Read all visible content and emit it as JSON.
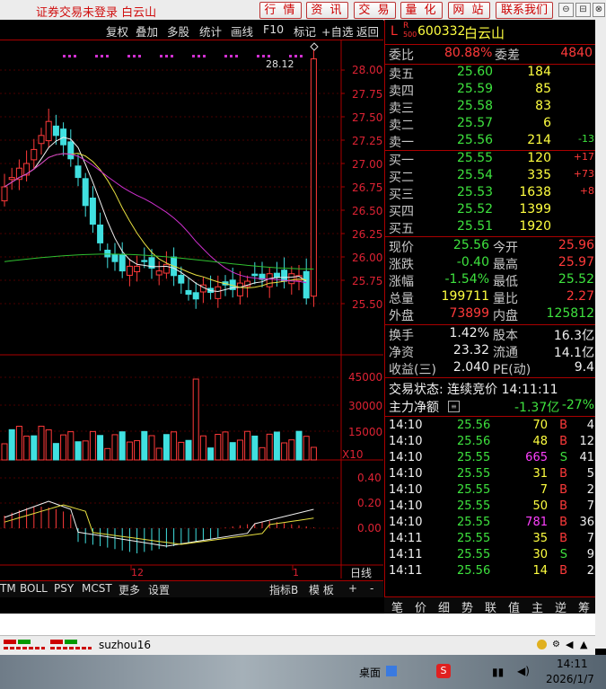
{
  "window": {
    "title": "证券交易未登录  白云山",
    "tabs": [
      "行 情",
      "资 讯",
      "交 易",
      "量 化",
      "网 站",
      "联系我们"
    ],
    "controls": [
      "⊖",
      "⊟",
      "⊗"
    ]
  },
  "chart_toolbar": [
    "复权",
    "叠加",
    "多股",
    "统计",
    "画线",
    "F10",
    "标记",
    "+自选",
    "返回"
  ],
  "price_axis": [
    "28.00",
    "27.75",
    "27.50",
    "27.25",
    "27.00",
    "26.75",
    "26.50",
    "26.25",
    "26.00",
    "25.75",
    "25.50"
  ],
  "volume_axis": [
    "45000",
    "30000",
    "15000",
    "X10"
  ],
  "macd_axis": [
    "0.40",
    "0.20",
    "0.00"
  ],
  "high_marker": "28.12",
  "date_labels": [
    "12",
    "1"
  ],
  "period_label": "日线",
  "chart_tabs": [
    "TM",
    "BOLL",
    "PSY",
    "MCST",
    "更多",
    "设置",
    "指标B",
    "模 板",
    "+",
    "-"
  ],
  "stock": {
    "code": "600332",
    "name": "白云山",
    "badge_top": "R",
    "badge_bottom": "500",
    "badge_left": "L"
  },
  "weibi": {
    "label": "委比",
    "value": "80.88%",
    "label2": "委差",
    "value2": "4840"
  },
  "sell": [
    {
      "label": "卖五",
      "price": "25.60",
      "vol": "184",
      "chg": ""
    },
    {
      "label": "卖四",
      "price": "25.59",
      "vol": "85",
      "chg": ""
    },
    {
      "label": "卖三",
      "price": "25.58",
      "vol": "83",
      "chg": ""
    },
    {
      "label": "卖二",
      "price": "25.57",
      "vol": "6",
      "chg": ""
    },
    {
      "label": "卖一",
      "price": "25.56",
      "vol": "214",
      "chg": "-13"
    }
  ],
  "buy": [
    {
      "label": "买一",
      "price": "25.55",
      "vol": "120",
      "chg": "+17"
    },
    {
      "label": "买二",
      "price": "25.54",
      "vol": "335",
      "chg": "+73"
    },
    {
      "label": "买三",
      "price": "25.53",
      "vol": "1638",
      "chg": "+8"
    },
    {
      "label": "买四",
      "price": "25.52",
      "vol": "1399",
      "chg": ""
    },
    {
      "label": "买五",
      "price": "25.51",
      "vol": "1920",
      "chg": ""
    }
  ],
  "stats": [
    {
      "l1": "现价",
      "v1": "25.56",
      "l2": "今开",
      "v2": "25.96"
    },
    {
      "l1": "涨跌",
      "v1": "-0.40",
      "l2": "最高",
      "v2": "25.97"
    },
    {
      "l1": "涨幅",
      "v1": "-1.54%",
      "l2": "最低",
      "v2": "25.52"
    },
    {
      "l1": "总量",
      "v1": "199711",
      "l2": "量比",
      "v2": "2.27"
    },
    {
      "l1": "外盘",
      "v1": "73899",
      "l2": "内盘",
      "v2": "125812"
    }
  ],
  "fundamentals": [
    {
      "l1": "换手",
      "v1": "1.42%",
      "l2": "股本",
      "v2": "16.3亿"
    },
    {
      "l1": "净资",
      "v1": "23.32",
      "l2": "流通",
      "v2": "14.1亿"
    },
    {
      "l1": "收益(三)",
      "v1": "2.040",
      "l2": "PE(动)",
      "v2": "9.4"
    }
  ],
  "trade_status": "交易状态: 连续竞价 14:11:11",
  "main_flow": {
    "label": "主力净额",
    "value": "-1.37亿",
    "pct": "-27%"
  },
  "trades": [
    {
      "t": "14:10",
      "p": "25.56",
      "v": "70",
      "s": "B",
      "n": "4"
    },
    {
      "t": "14:10",
      "p": "25.56",
      "v": "48",
      "s": "B",
      "n": "12"
    },
    {
      "t": "14:10",
      "p": "25.55",
      "v": "665",
      "s": "S",
      "n": "41"
    },
    {
      "t": "14:10",
      "p": "25.55",
      "v": "31",
      "s": "B",
      "n": "5"
    },
    {
      "t": "14:10",
      "p": "25.55",
      "v": "7",
      "s": "B",
      "n": "2"
    },
    {
      "t": "14:10",
      "p": "25.55",
      "v": "50",
      "s": "B",
      "n": "7"
    },
    {
      "t": "14:10",
      "p": "25.55",
      "v": "781",
      "s": "B",
      "n": "36"
    },
    {
      "t": "14:11",
      "p": "25.55",
      "v": "35",
      "s": "B",
      "n": "7"
    },
    {
      "t": "14:11",
      "p": "25.55",
      "v": "30",
      "s": "S",
      "n": "9"
    },
    {
      "t": "14:11",
      "p": "25.56",
      "v": "14",
      "s": "B",
      "n": "2"
    }
  ],
  "quote_tabs": [
    "笔",
    "价",
    "细",
    "势",
    "联",
    "值",
    "主",
    "逆",
    "筹"
  ],
  "status": {
    "user": "suzhou16"
  },
  "taskbar": {
    "desktop": "桌面",
    "time": "14:11",
    "date": "2026/1/7"
  }
}
